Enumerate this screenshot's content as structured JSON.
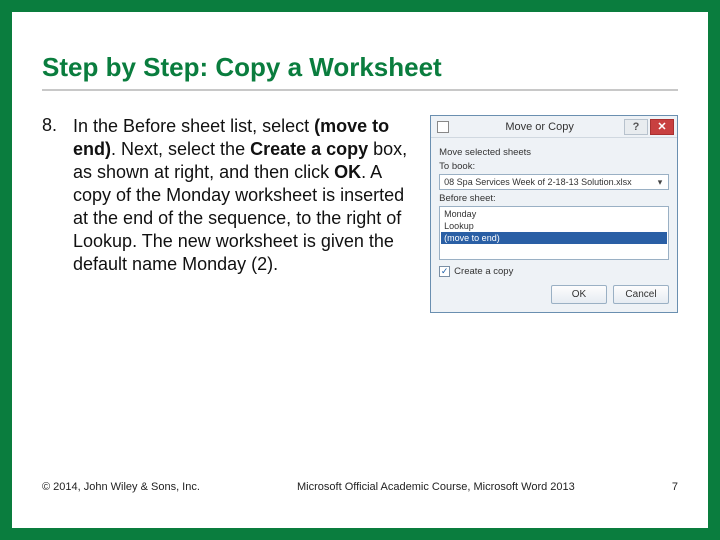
{
  "title": "Step by Step: Copy a Worksheet",
  "step": {
    "number": "8.",
    "text_parts": [
      "In the Before sheet list, select ",
      "(move to end)",
      ". Next, select the ",
      "Create a copy ",
      "box, as shown at right, and then click ",
      "OK",
      ". A copy of the Monday worksheet is inserted at the end of the sequence, to the right of Lookup. The new worksheet is given the default name Monday (2)."
    ]
  },
  "dialog": {
    "title": "Move or Copy",
    "help_symbol": "?",
    "close_symbol": "✕",
    "move_label": "Move selected sheets",
    "to_book_label": "To book:",
    "to_book_value": "08 Spa Services Week of 2-18-13 Solution.xlsx",
    "before_label": "Before sheet:",
    "list": {
      "item1": "Monday",
      "item2": "Lookup",
      "item3_selected": "(move to end)"
    },
    "checkbox": {
      "mark": "✓",
      "label": "Create a copy"
    },
    "ok": "OK",
    "cancel": "Cancel"
  },
  "footer": {
    "left": "© 2014, John Wiley & Sons, Inc.",
    "center": "Microsoft Official Academic Course, Microsoft Word 2013",
    "right": "7"
  }
}
